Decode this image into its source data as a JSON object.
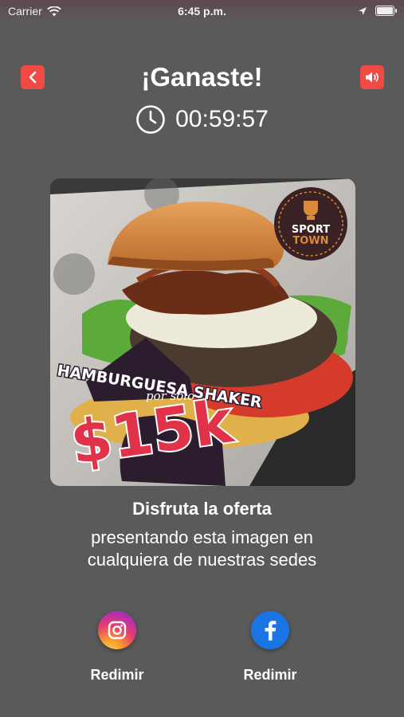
{
  "status_bar": {
    "carrier": "Carrier",
    "time": "6:45 p.m."
  },
  "header": {
    "title": "¡Ganaste!",
    "countdown": "00:59:57",
    "back_icon": "chevron-left-icon",
    "sound_icon": "speaker-icon"
  },
  "promo": {
    "brand_line1": "SPORT",
    "brand_line2": "TOWN",
    "product": "HAMBURGUESA SHAKER",
    "price_prefix": "por solo",
    "price": "$15k"
  },
  "offer": {
    "heading": "Disfruta la oferta",
    "line1": "presentando esta imagen en",
    "line2": "cualquiera de nuestras sedes"
  },
  "redeem": {
    "instagram_label": "Redimir",
    "facebook_label": "Redimir"
  },
  "colors": {
    "background": "#5a5a5a",
    "accent": "#ef4a44",
    "facebook": "#1b74e4"
  }
}
